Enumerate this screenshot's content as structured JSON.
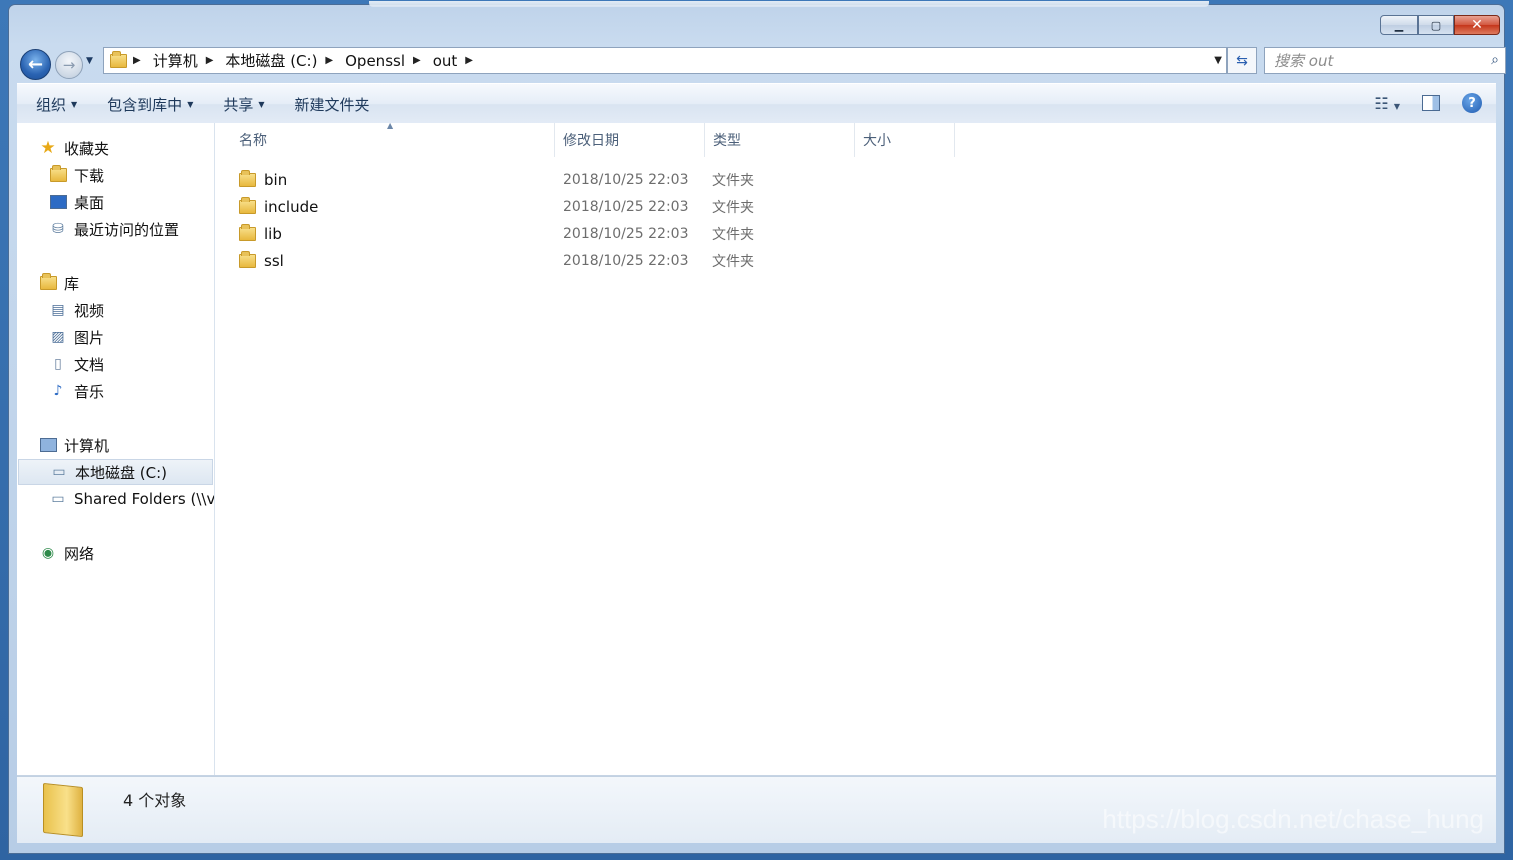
{
  "window": {
    "caption_buttons": [
      "minimize",
      "maximize",
      "close"
    ]
  },
  "address": {
    "crumbs": [
      "计算机",
      "本地磁盘 (C:)",
      "Openssl",
      "out"
    ]
  },
  "search": {
    "placeholder": "搜索 out"
  },
  "toolbar": {
    "organize": "组织",
    "include_in_library": "包含到库中",
    "share": "共享",
    "new_folder": "新建文件夹"
  },
  "nav": {
    "favorites": "收藏夹",
    "downloads": "下载",
    "desktop": "桌面",
    "recent": "最近访问的位置",
    "libraries": "库",
    "videos": "视频",
    "pictures": "图片",
    "documents": "文档",
    "music": "音乐",
    "computer": "计算机",
    "local_disk": "本地磁盘 (C:)",
    "shared_folders": "Shared Folders (\\\\v",
    "network": "网络"
  },
  "columns": {
    "name": "名称",
    "modified": "修改日期",
    "type": "类型",
    "size": "大小"
  },
  "files": [
    {
      "name": "bin",
      "modified": "2018/10/25 22:03",
      "type": "文件夹"
    },
    {
      "name": "include",
      "modified": "2018/10/25 22:03",
      "type": "文件夹"
    },
    {
      "name": "lib",
      "modified": "2018/10/25 22:03",
      "type": "文件夹"
    },
    {
      "name": "ssl",
      "modified": "2018/10/25 22:03",
      "type": "文件夹"
    }
  ],
  "details": {
    "count_text": "4 个对象"
  },
  "watermark": "https://blog.csdn.net/chase_hung"
}
